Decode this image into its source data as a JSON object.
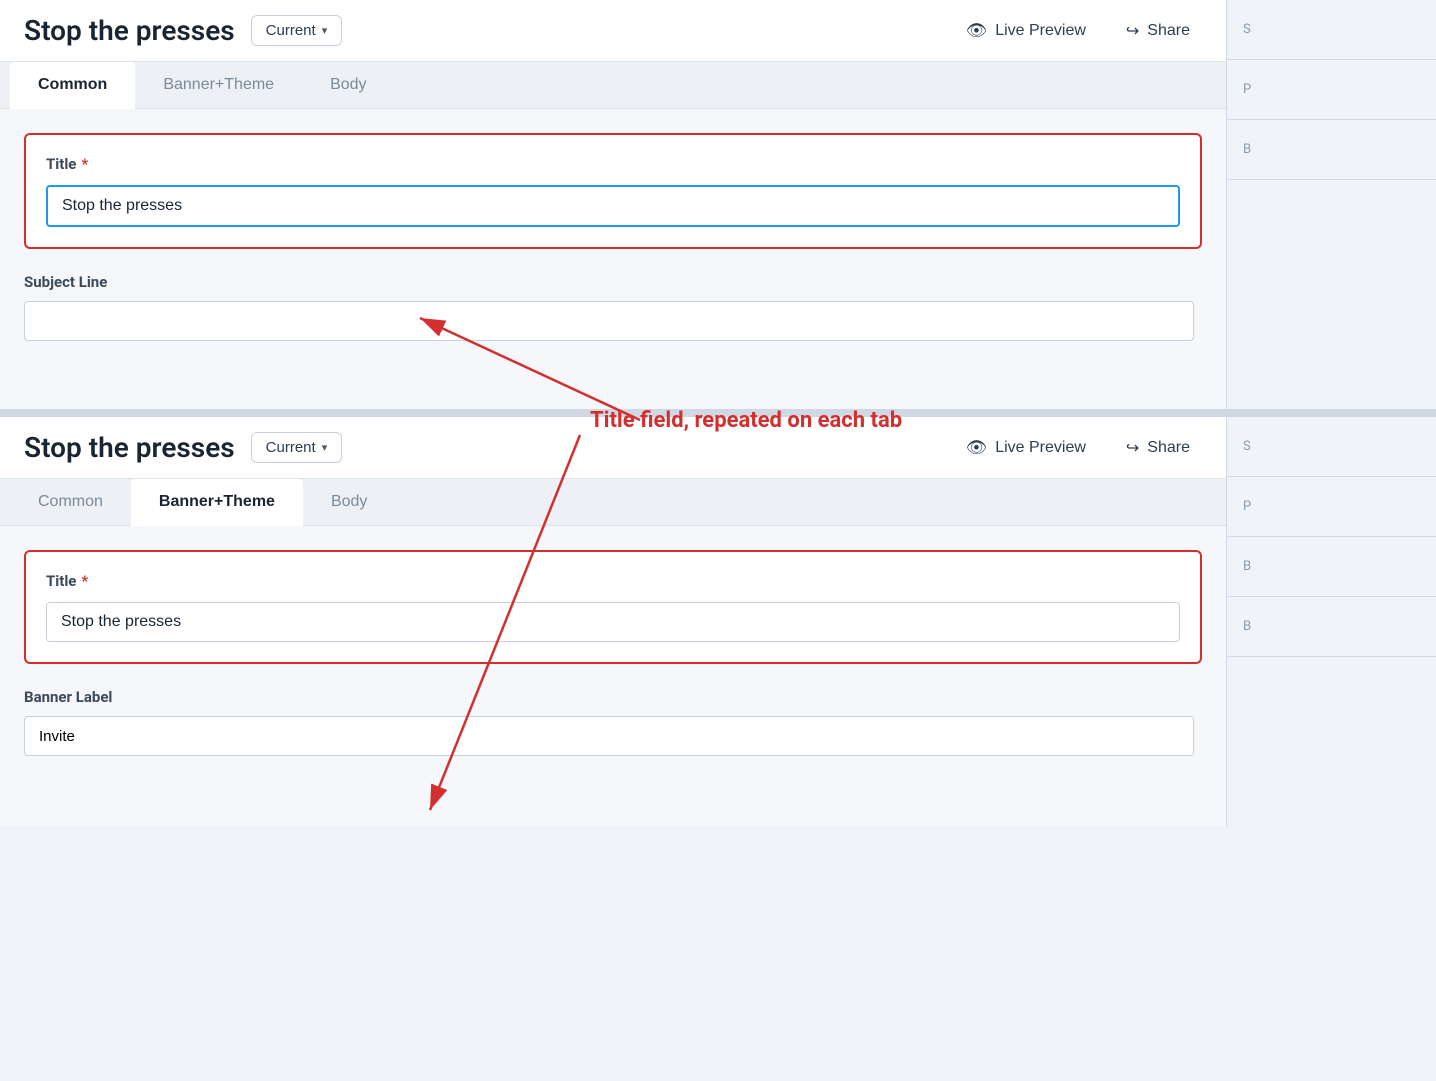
{
  "header": {
    "title": "Stop the presses",
    "version_label": "Current",
    "chevron": "▾",
    "live_preview_label": "Live Preview",
    "share_label": "Share"
  },
  "tabs_top": {
    "items": [
      {
        "id": "common",
        "label": "Common",
        "active": true
      },
      {
        "id": "banner-theme",
        "label": "Banner+Theme",
        "active": false
      },
      {
        "id": "body",
        "label": "Body",
        "active": false
      }
    ]
  },
  "tabs_bottom": {
    "items": [
      {
        "id": "common2",
        "label": "Common",
        "active": false
      },
      {
        "id": "banner-theme2",
        "label": "Banner+Theme",
        "active": true
      },
      {
        "id": "body2",
        "label": "Body",
        "active": false
      }
    ]
  },
  "top_form": {
    "title_label": "Title",
    "title_required": "*",
    "title_value": "Stop the presses",
    "subject_label": "Subject Line",
    "subject_placeholder": ""
  },
  "bottom_form": {
    "title_label": "Title",
    "title_required": "*",
    "title_value": "Stop the presses",
    "banner_label": "Banner Label",
    "banner_value": "Invite"
  },
  "annotation": {
    "text": "Title field, repeated on each tab"
  },
  "right_side": {
    "items": [
      "S",
      "P",
      "B",
      "B",
      "B"
    ]
  }
}
